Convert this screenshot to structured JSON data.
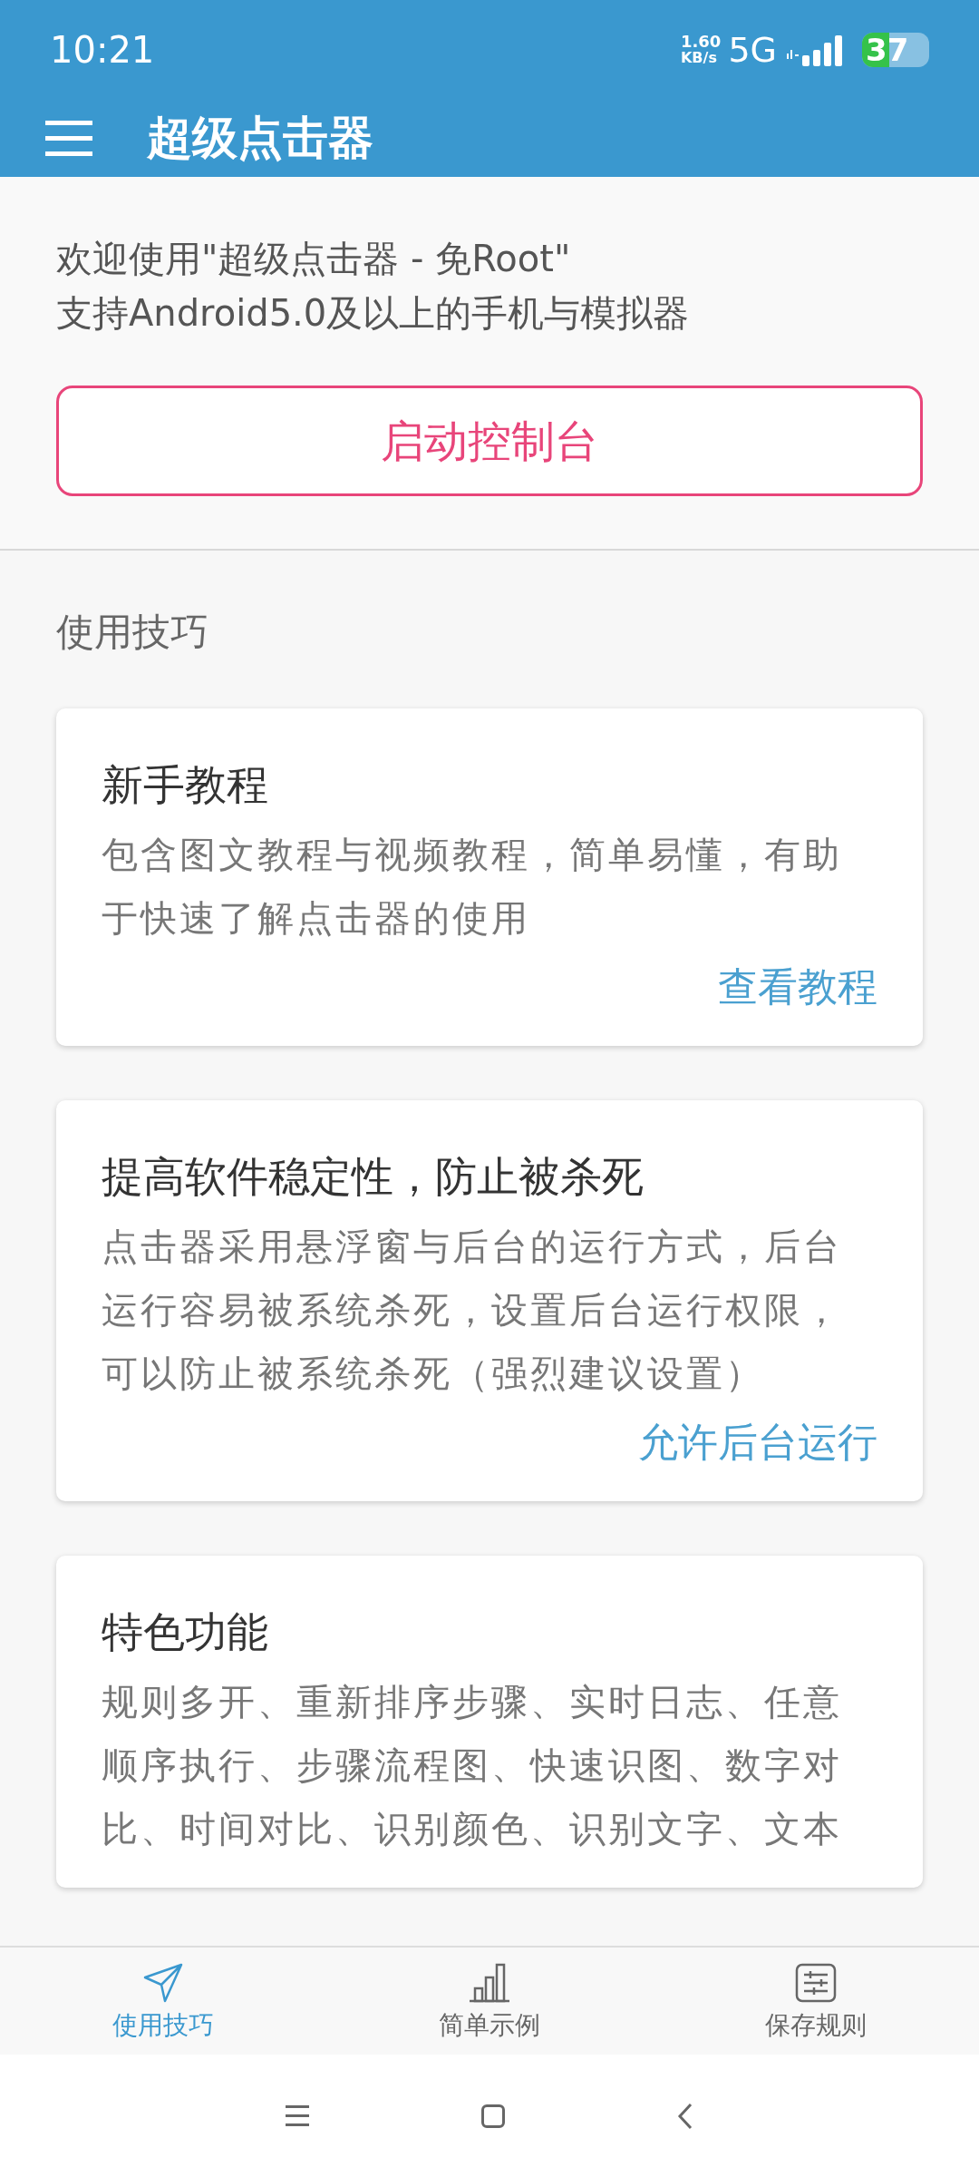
{
  "status_bar": {
    "time": "10:21",
    "speed_value": "1.60",
    "speed_unit": "KB/s",
    "network": "5G",
    "battery": "37"
  },
  "app_bar": {
    "title": "超级点击器"
  },
  "welcome": {
    "lines": [
      "欢迎使用\"超级点击器 - 免Root\"",
      "支持Android5.0及以上的手机与模拟器"
    ],
    "button": "启动控制台"
  },
  "section_title": "使用技巧",
  "cards": [
    {
      "title": "新手教程",
      "body": "包含图文教程与视频教程，简单易懂，有助于快速了解点击器的使用",
      "link": "查看教程"
    },
    {
      "title": "提高软件稳定性，防止被杀死",
      "body": "点击器采用悬浮窗与后台的运行方式，后台运行容易被系统杀死，设置后台运行权限，可以防止被系统杀死（强烈建议设置）",
      "link": "允许后台运行"
    },
    {
      "title": "特色功能",
      "body": "规则多开、重新排序步骤、实时日志、任意顺序执行、步骤流程图、快速识图、数字对比、时间对比、识别颜色、识别文字、文本"
    }
  ],
  "bottom_nav": [
    {
      "label": "使用技巧",
      "kind": "send",
      "selected": true
    },
    {
      "label": "简单示例",
      "kind": "chart",
      "selected": false
    },
    {
      "label": "保存规则",
      "kind": "sliders",
      "selected": false
    }
  ]
}
